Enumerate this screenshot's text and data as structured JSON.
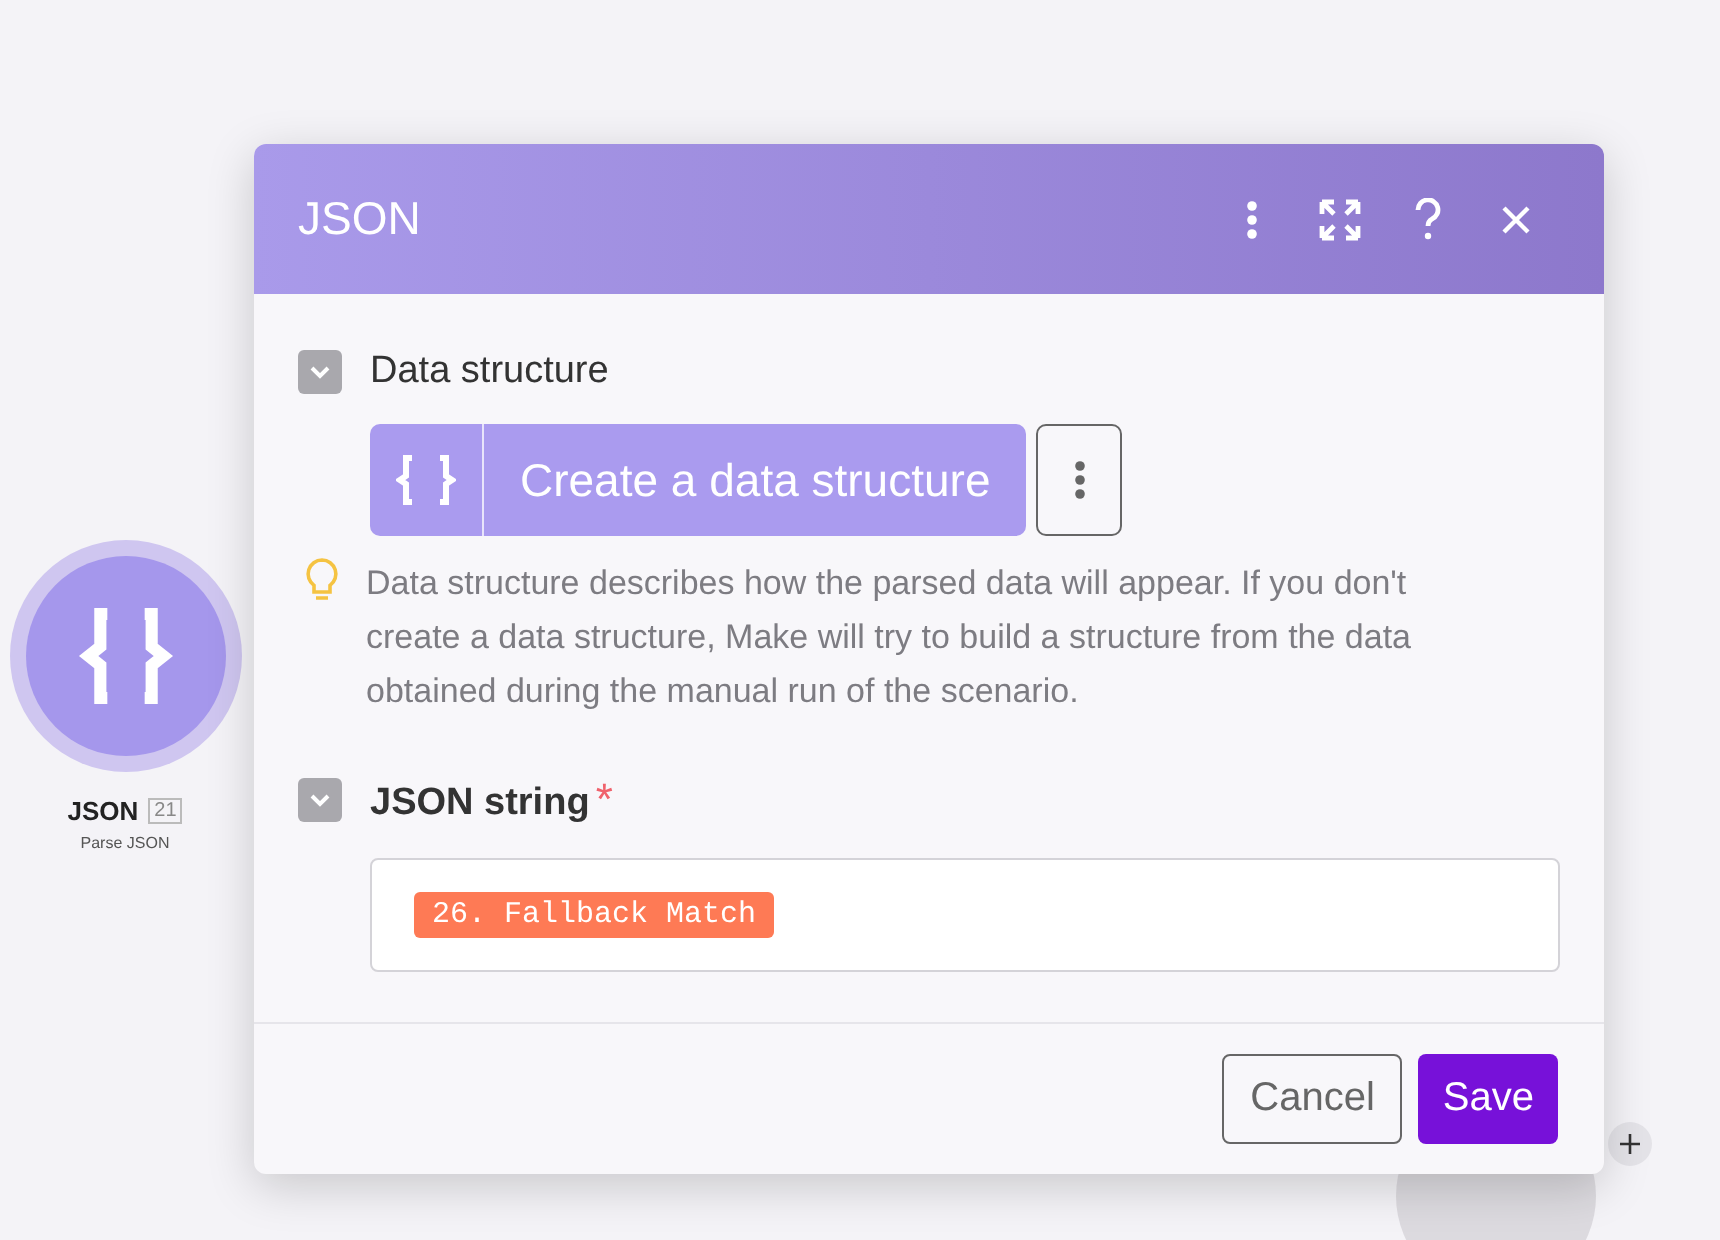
{
  "node": {
    "title": "JSON",
    "badge": "21",
    "subtitle": "Parse JSON"
  },
  "dialog": {
    "title": "JSON",
    "data_structure": {
      "label": "Data structure",
      "expanded": true,
      "button": "Create a data structure",
      "hint": "Data structure describes how the parsed data will appear. If you don't create a data structure, Make will try to build a structure from the data obtained during the manual run of the scenario."
    },
    "json_string": {
      "label": "JSON string",
      "expanded": true,
      "required": true,
      "required_mark": "*",
      "token": "26. Fallback Match"
    },
    "buttons": {
      "cancel": "Cancel",
      "save": "Save"
    }
  }
}
